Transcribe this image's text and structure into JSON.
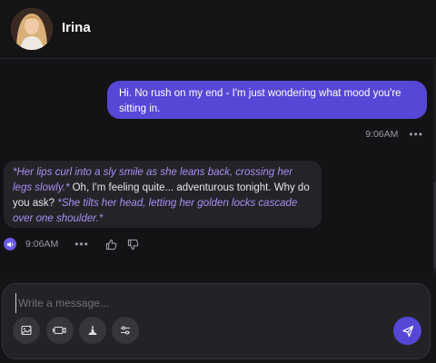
{
  "header": {
    "name": "Irina"
  },
  "messages": {
    "user": {
      "text": "Hi. No rush on my end - I'm just wondering what mood you're sitting in.",
      "time": "9:06AM",
      "more": "•••"
    },
    "bot": {
      "part1": "*Her lips curl into a sly smile as she leans back, crossing her legs slowly.*",
      "part2": " Oh, I'm feeling quite... adventurous tonight. Why do you ask? ",
      "part3": "*She tilts her head, letting her golden locks cascade over one shoulder.*",
      "time": "9:06AM",
      "more": "•••"
    }
  },
  "composer": {
    "placeholder": "Write a message..."
  },
  "icons": {
    "avatar": "avatar-portrait",
    "speaker": "speaker-icon",
    "thumbs_up": "thumbs-up-icon",
    "thumbs_down": "thumbs-down-icon",
    "image_gen": "image-generate-icon",
    "video": "video-icon",
    "suggest": "magic-reply-icon",
    "settings": "sliders-icon",
    "send": "send-icon"
  },
  "colors": {
    "accent": "#5647d6",
    "emote": "#a98ff5",
    "bot_bubble": "#242428",
    "background": "#151517"
  }
}
